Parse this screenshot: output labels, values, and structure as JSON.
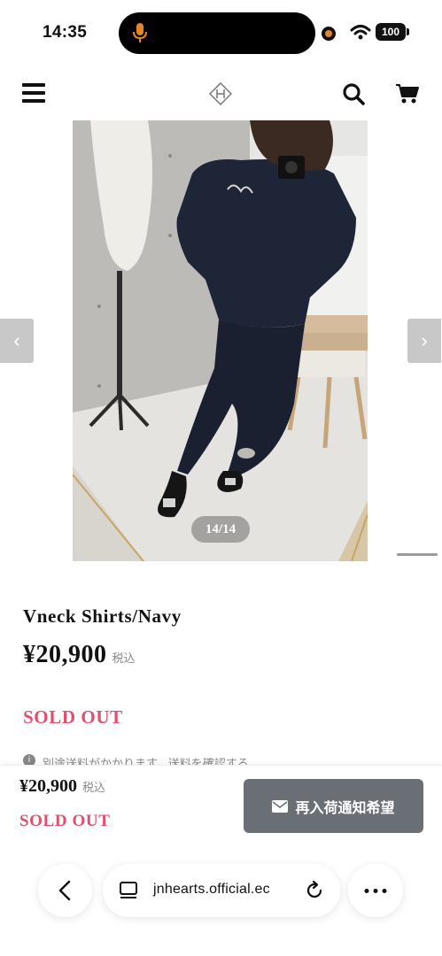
{
  "status_bar": {
    "time": "14:35",
    "battery": "100"
  },
  "header": {
    "icons": [
      "menu-icon",
      "logo-icon",
      "search-icon",
      "cart-icon"
    ]
  },
  "gallery": {
    "counter": "14/14",
    "prev_glyph": "‹",
    "next_glyph": "›"
  },
  "product": {
    "title": "Vneck Shirts/Navy",
    "price": "¥20,900",
    "tax_label": "税込",
    "status": "SOLD OUT",
    "shipping_note": "別途送料がかかります。送料を確認する"
  },
  "sticky_bar": {
    "price": "¥20,900",
    "tax_label": "税込",
    "status": "SOLD OUT",
    "notify_label": "再入荷通知希望"
  },
  "browser": {
    "url": "jnhearts.official.ec"
  },
  "colors": {
    "sold_out": "#e0506e",
    "notify_button": "#6a6f76",
    "mic_indicator": "#e2852b"
  }
}
